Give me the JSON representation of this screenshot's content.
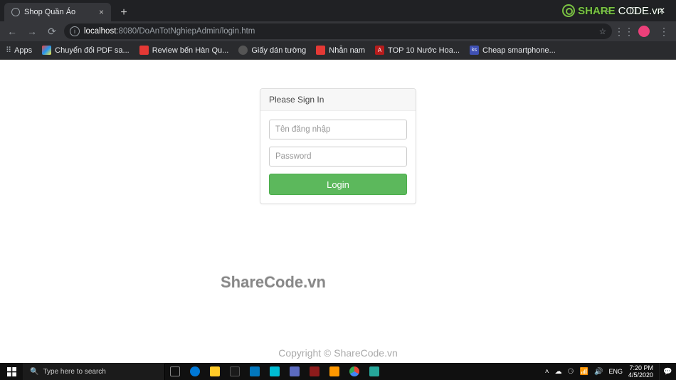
{
  "browser": {
    "tab_title": "Shop Quần Áo",
    "url_host": "localhost",
    "url_port": ":8080",
    "url_path": "/DoAnTotNghiepAdmin/login.htm",
    "bookmarks_label": "Apps",
    "bookmarks": [
      {
        "label": "Chuyển đổi PDF sa...",
        "color": "#ffffff"
      },
      {
        "label": "Review bến Hàn Qu...",
        "color": "#e53935"
      },
      {
        "label": "Giấy dán tường",
        "color": "#9e9e9e"
      },
      {
        "label": "Nhẫn nam",
        "color": "#e53935"
      },
      {
        "label": "TOP 10 Nước Hoa...",
        "color": "#d32f2f"
      },
      {
        "label": "Cheap smartphone...",
        "color": "#3f51b5"
      }
    ]
  },
  "login": {
    "header": "Please Sign In",
    "username_placeholder": "Tên đăng nhập",
    "password_placeholder": "Password",
    "button_label": "Login"
  },
  "watermarks": {
    "center": "ShareCode.vn",
    "bottom": "Copyright © ShareCode.vn",
    "logo_green": "SHARE",
    "logo_white": "CODE.vn"
  },
  "taskbar": {
    "search_placeholder": "Type here to search",
    "lang": "ENG",
    "time": "7:20 PM",
    "date": "4/5/2020"
  }
}
